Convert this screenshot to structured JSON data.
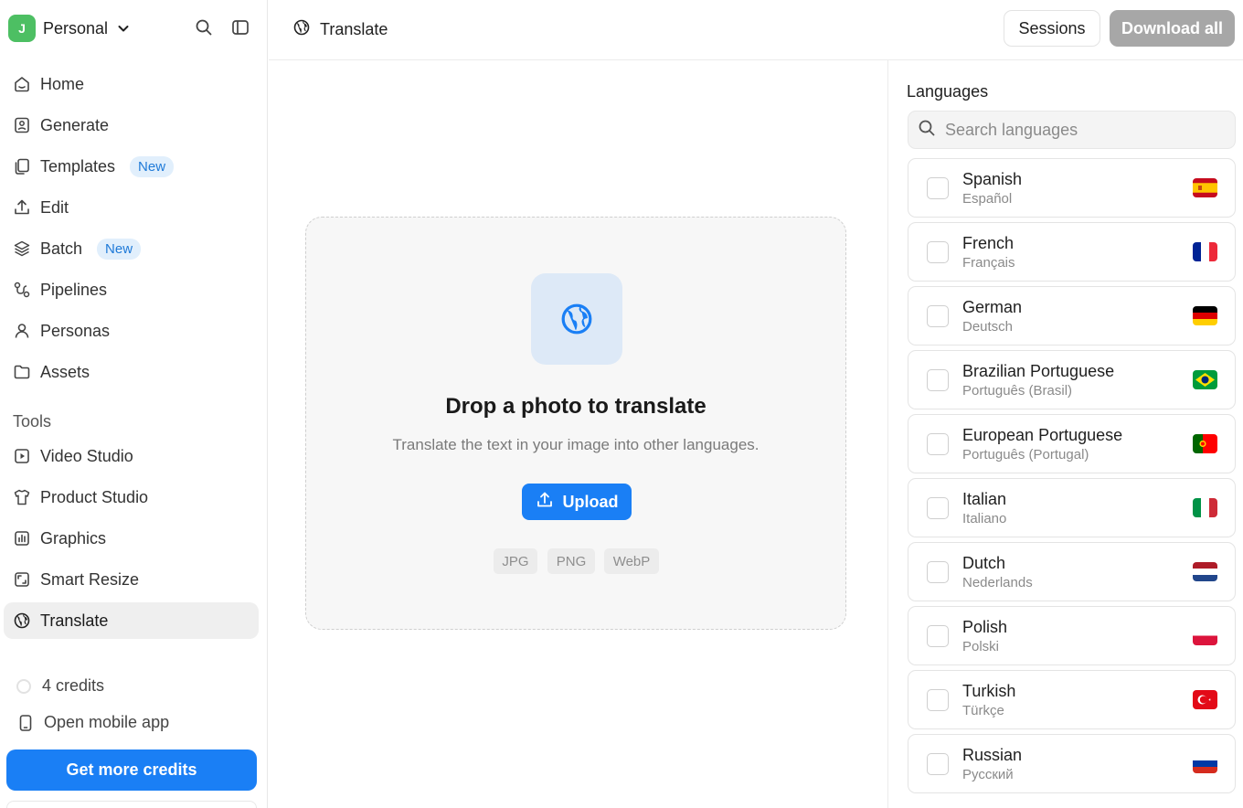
{
  "workspace": {
    "initial": "J",
    "name": "Personal"
  },
  "nav": {
    "items": [
      {
        "label": "Home",
        "icon": "home-icon"
      },
      {
        "label": "Generate",
        "icon": "image-icon"
      },
      {
        "label": "Templates",
        "icon": "copy-icon",
        "badge": "New"
      },
      {
        "label": "Edit",
        "icon": "upload-icon"
      },
      {
        "label": "Batch",
        "icon": "layers-icon",
        "badge": "New"
      },
      {
        "label": "Pipelines",
        "icon": "route-icon"
      },
      {
        "label": "Personas",
        "icon": "user-icon"
      },
      {
        "label": "Assets",
        "icon": "folder-icon"
      }
    ],
    "tools_label": "Tools",
    "tools": [
      {
        "label": "Video Studio",
        "icon": "play-icon"
      },
      {
        "label": "Product Studio",
        "icon": "shirt-icon"
      },
      {
        "label": "Graphics",
        "icon": "chart-icon"
      },
      {
        "label": "Smart Resize",
        "icon": "resize-icon"
      },
      {
        "label": "Translate",
        "icon": "globe-icon",
        "active": true
      }
    ],
    "credits": "4 credits",
    "mobile_app": "Open mobile app",
    "cta": "Get more credits"
  },
  "header": {
    "title": "Translate",
    "sessions": "Sessions",
    "download_all": "Download all"
  },
  "dropzone": {
    "title": "Drop a photo to translate",
    "subtitle": "Translate the text in your image into other languages.",
    "upload": "Upload",
    "formats": [
      "JPG",
      "PNG",
      "WebP"
    ]
  },
  "languages": {
    "title": "Languages",
    "search_placeholder": "Search languages",
    "items": [
      {
        "name": "Spanish",
        "native": "Español",
        "flag": "spain-flag-icon"
      },
      {
        "name": "French",
        "native": "Français",
        "flag": "france-flag-icon"
      },
      {
        "name": "German",
        "native": "Deutsch",
        "flag": "germany-flag-icon"
      },
      {
        "name": "Brazilian Portuguese",
        "native": "Português (Brasil)",
        "flag": "brazil-flag-icon"
      },
      {
        "name": "European Portuguese",
        "native": "Português (Portugal)",
        "flag": "portugal-flag-icon"
      },
      {
        "name": "Italian",
        "native": "Italiano",
        "flag": "italy-flag-icon"
      },
      {
        "name": "Dutch",
        "native": "Nederlands",
        "flag": "netherlands-flag-icon"
      },
      {
        "name": "Polish",
        "native": "Polski",
        "flag": "poland-flag-icon"
      },
      {
        "name": "Turkish",
        "native": "Türkçe",
        "flag": "turkey-flag-icon"
      },
      {
        "name": "Russian",
        "native": "Русский",
        "flag": "russia-flag-icon"
      }
    ]
  },
  "colors": {
    "accent": "#1a7ff5",
    "workspace_avatar": "#4dbf63",
    "badge_bg": "#e1effc",
    "badge_text": "#1f7ad8",
    "disabled_button": "#a7a7a7"
  }
}
